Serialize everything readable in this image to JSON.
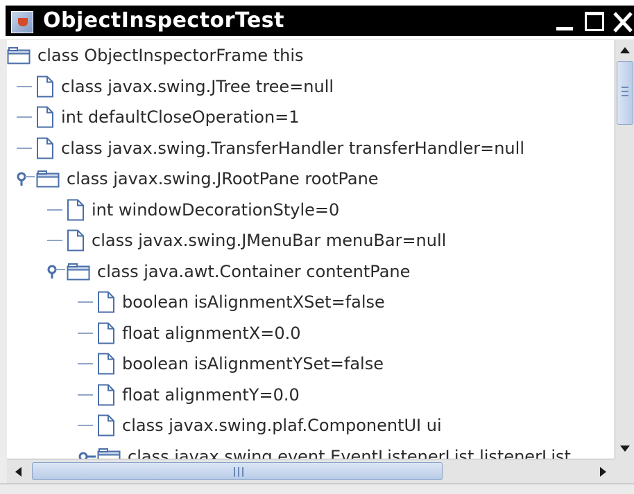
{
  "window": {
    "title": "ObjectInspectorTest",
    "title_bar_color": "#000000",
    "title_text_color": "#ffffff",
    "buttons": [
      "minimize",
      "maximize",
      "close"
    ]
  },
  "tree": {
    "line_color": "#8fa6c8",
    "icon_color": "#4a6ea9",
    "nodes": [
      {
        "depth": 0,
        "type": "folder",
        "expanded": true,
        "handle": "none",
        "label": "class ObjectInspectorFrame this"
      },
      {
        "depth": 1,
        "type": "file",
        "label": "class javax.swing.JTree tree=null"
      },
      {
        "depth": 1,
        "type": "file",
        "label": "int defaultCloseOperation=1"
      },
      {
        "depth": 1,
        "type": "file",
        "label": "class javax.swing.TransferHandler transferHandler=null"
      },
      {
        "depth": 1,
        "type": "folder",
        "expanded": true,
        "handle": "expanded",
        "label": "class javax.swing.JRootPane rootPane"
      },
      {
        "depth": 2,
        "type": "file",
        "label": "int windowDecorationStyle=0"
      },
      {
        "depth": 2,
        "type": "file",
        "label": "class javax.swing.JMenuBar menuBar=null"
      },
      {
        "depth": 2,
        "type": "folder",
        "expanded": true,
        "handle": "expanded",
        "label": "class java.awt.Container contentPane"
      },
      {
        "depth": 3,
        "type": "file",
        "label": "boolean isAlignmentXSet=false"
      },
      {
        "depth": 3,
        "type": "file",
        "label": "float alignmentX=0.0"
      },
      {
        "depth": 3,
        "type": "file",
        "label": "boolean isAlignmentYSet=false"
      },
      {
        "depth": 3,
        "type": "file",
        "label": "float alignmentY=0.0"
      },
      {
        "depth": 3,
        "type": "file",
        "label": "class javax.swing.plaf.ComponentUI ui"
      },
      {
        "depth": 3,
        "type": "folder",
        "expanded": false,
        "handle": "collapsed",
        "label": "class javax.swing.event.EventListenerList listenerList"
      }
    ]
  },
  "scrollbars": {
    "vertical": {
      "position_fraction": 0.0
    },
    "horizontal": {
      "position_fraction": 0.0
    }
  }
}
